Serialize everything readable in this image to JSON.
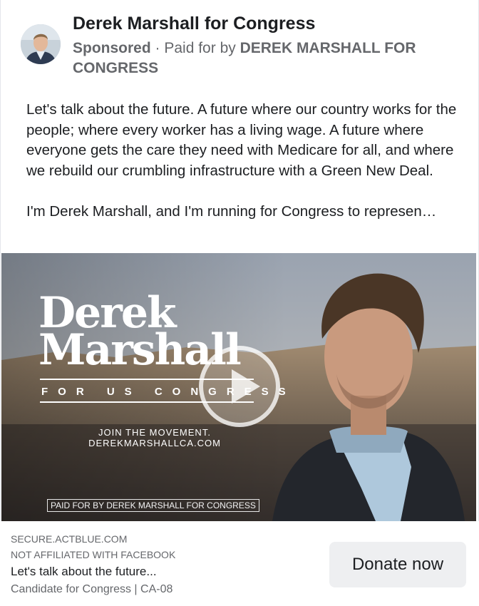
{
  "header": {
    "page_name": "Derek Marshall for Congress",
    "sponsored": "Sponsored",
    "separator": " · ",
    "paid_prefix": "Paid for by ",
    "paid_by": "DEREK MARSHALL FOR CONGRESS"
  },
  "post": {
    "paragraph1": "Let's talk about the future. A future where our country works for the people; where every worker has a living wage. A future where everyone gets the care they need with Medicare for all, and where we rebuild our crumbling infrastructure with a Green New Deal.",
    "paragraph2": "I'm Derek Marshall, and I'm running for Congress to represen…"
  },
  "media": {
    "logo_line1": "Derek",
    "logo_line2": "Marshall",
    "logo_sub": "FOR US CONGRESS",
    "join_line1": "JOIN THE MOVEMENT.",
    "join_line2": "DEREKMARSHALLCA.COM",
    "paid_badge": "PAID FOR BY DEREK MARSHALL FOR CONGRESS",
    "play_icon": "play-icon"
  },
  "footer": {
    "domain": "SECURE.ACTBLUE.COM",
    "affiliation": "NOT AFFILIATED WITH FACEBOOK",
    "headline": "Let's talk about the future...",
    "description": "Candidate for Congress | CA-08",
    "cta_label": "Donate now"
  }
}
